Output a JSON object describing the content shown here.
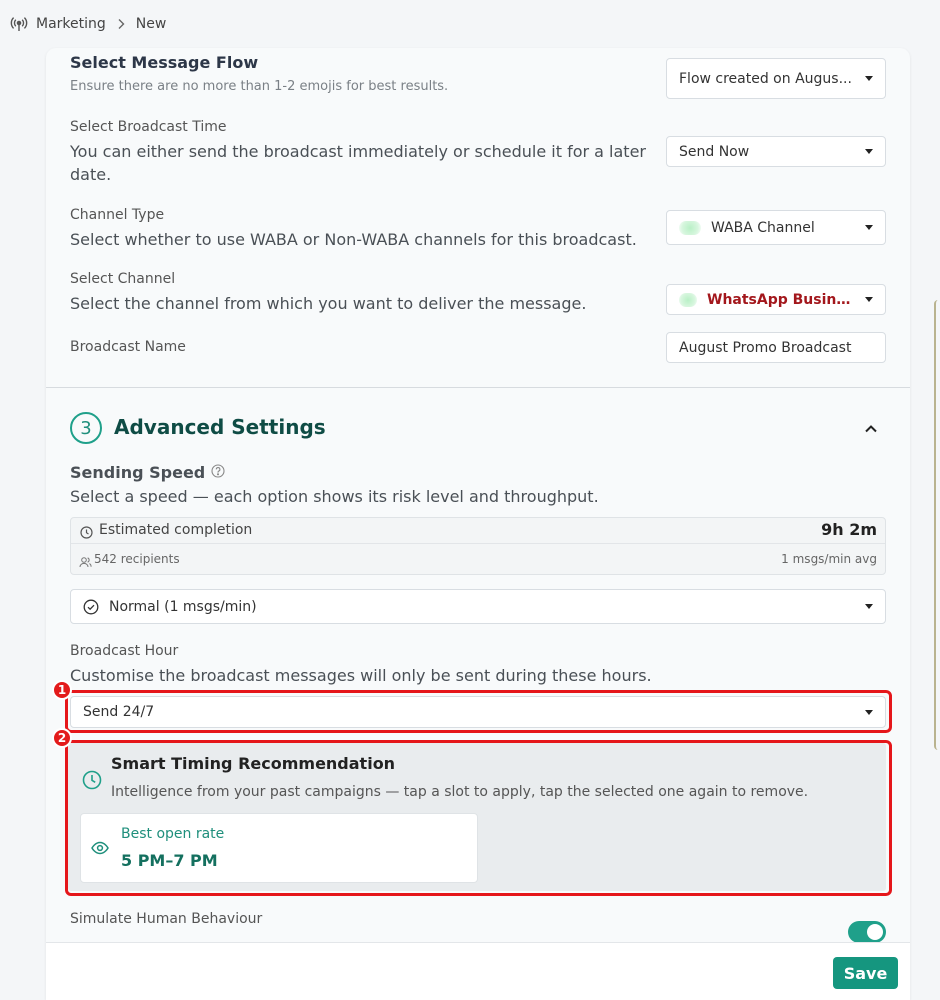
{
  "breadcrumb": {
    "root": "Marketing",
    "current": "New",
    "root_icon": "broadcast-icon",
    "separator_icon": "chevron-right-icon"
  },
  "message_flow": {
    "title": "Select Message Flow",
    "hint": "Ensure there are no more than 1-2 emojis for best results.",
    "selected": "Flow created on Augus..."
  },
  "broadcast_time": {
    "label": "Select Broadcast Time",
    "description": "You can either send the broadcast immediately or schedule it for a later date.",
    "selected": "Send Now"
  },
  "channel_type": {
    "label": "Channel Type",
    "description": "Select whether to use WABA or Non-WABA channels for this broadcast.",
    "selected": "WABA Channel"
  },
  "channel": {
    "label": "Select Channel",
    "description": "Select the channel from which you want to deliver the message.",
    "selected": "WhatsApp Busine...",
    "selected_color": "#a3171c"
  },
  "broadcast_name": {
    "label": "Broadcast Name",
    "value": "August Promo Broadcast"
  },
  "advanced": {
    "step_number": "3",
    "title": "Advanced Settings",
    "collapse_icon": "chevron-up-icon"
  },
  "sending_speed": {
    "title": "Sending Speed",
    "description": "Select a speed — each option shows its risk level and throughput.",
    "estimate_label": "Estimated completion",
    "estimate_value": "9h 2m",
    "recipients": "542 recipients",
    "rate": "1 msgs/min avg",
    "selected": "Normal (1 msgs/min)"
  },
  "broadcast_hour": {
    "label": "Broadcast Hour",
    "description": "Customise the broadcast messages will only be sent during these hours.",
    "selected": "Send 24/7"
  },
  "smart_timing": {
    "title": "Smart Timing Recommendation",
    "description": "Intelligence from your past campaigns — tap a slot to apply, tap the selected one again to remove.",
    "slot_label": "Best open rate",
    "slot_value": "5 PM–7 PM"
  },
  "human_behaviour": {
    "label": "Simulate Human Behaviour",
    "enabled": true
  },
  "annotations": [
    "1",
    "2"
  ],
  "footer": {
    "save_label": "Save"
  },
  "colors": {
    "accent": "#15967f",
    "highlight": "#e5161a",
    "heading": "#0f4c45"
  }
}
